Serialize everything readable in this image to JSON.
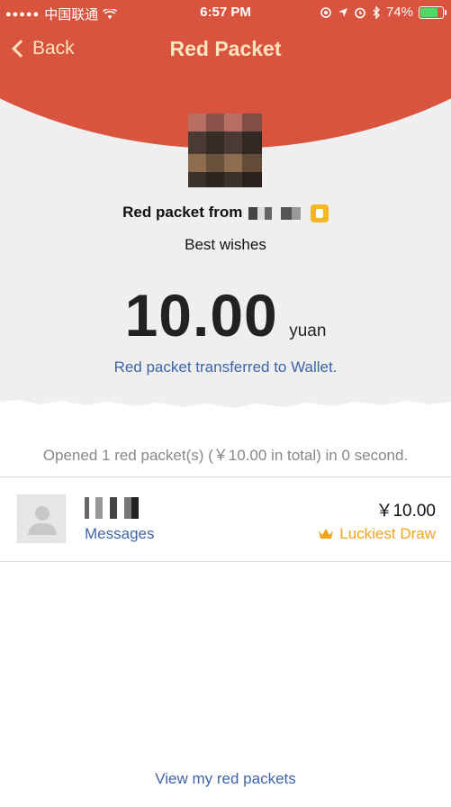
{
  "status_bar": {
    "carrier": "中国联通",
    "time": "6:57 PM",
    "battery": "74%",
    "battery_level": 0.74
  },
  "nav": {
    "back_label": "Back",
    "title": "Red Packet"
  },
  "packet": {
    "sender_prefix": "Red packet from",
    "wishes": "Best wishes",
    "amount": "10.00",
    "unit": "yuan",
    "wallet_link": "Red packet transferred to Wallet."
  },
  "summary": "Opened 1 red packet(s) (￥10.00 in total) in 0 second.",
  "receiver": {
    "messages": "Messages",
    "amount": "￥10.00",
    "badge": "Luckiest Draw"
  },
  "footer": {
    "view_link": "View my red packets"
  },
  "colors": {
    "header_red": "#d9543f",
    "title_gold": "#fde3bd",
    "link_blue": "#3f65a8",
    "luckiest_gold": "#f0a41e"
  },
  "icons": [
    "signal-icon",
    "wifi-icon",
    "location-icon",
    "alarm-icon",
    "bluetooth-icon",
    "battery-icon",
    "back-chevron-icon",
    "verified-icon",
    "default-avatar-icon",
    "crown-icon"
  ]
}
